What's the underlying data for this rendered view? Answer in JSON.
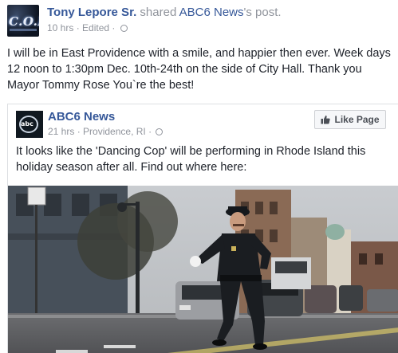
{
  "post": {
    "author": "Tony Lepore Sr.",
    "shared_word": "shared",
    "page_ref": "ABC6 News",
    "possessive": "'s post.",
    "time": "10 hrs",
    "edited": "Edited",
    "text": "I will be in East Providence with a smile, and happier then ever. Week days 12 noon to 1:30pm Dec. 10th-24th on the side of City Hall. Thank you Mayor Tommy Rose You`re the best!",
    "avatar_text": "C.O.P."
  },
  "shared_card": {
    "page_name": "ABC6 News",
    "time": "21 hrs",
    "location": "Providence, RI",
    "like_button": "Like Page",
    "text": "It looks like the 'Dancing Cop' will be performing in Rhode Island this holiday season after all. Find out where here:",
    "avatar_text": "abc 6"
  },
  "colors": {
    "link": "#365899",
    "meta": "#90949c",
    "text": "#1d2129"
  },
  "icons": [
    "globe-icon",
    "thumbs-up-icon"
  ]
}
